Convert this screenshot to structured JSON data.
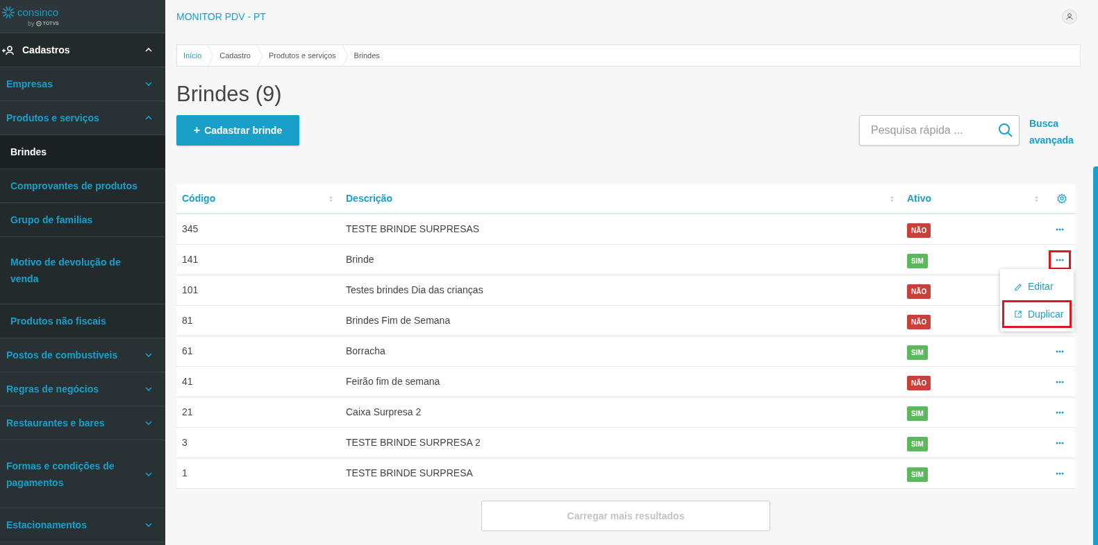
{
  "logo": {
    "name": "consinco",
    "by": "by",
    "brand": "TOTVS"
  },
  "sidebar": {
    "section": {
      "label": "Cadastros",
      "expanded": true
    },
    "items": [
      {
        "label": "Empresas",
        "expanded": false
      },
      {
        "label": "Produtos e serviços",
        "expanded": true,
        "children": [
          {
            "label": "Brindes",
            "selected": true
          },
          {
            "label": "Comprovantes de produtos",
            "selected": false
          },
          {
            "label": "Grupo de familias",
            "selected": false
          },
          {
            "label": "Motivo de devolução de venda",
            "selected": false
          },
          {
            "label": "Produtos não fiscais",
            "selected": false
          }
        ]
      },
      {
        "label": "Postos de combustiveis",
        "expanded": false
      },
      {
        "label": "Regras de negócios",
        "expanded": false
      },
      {
        "label": "Restaurantes e bares",
        "expanded": false
      },
      {
        "label": "Formas e condições de pagamentos",
        "expanded": false
      },
      {
        "label": "Estacionamentos",
        "expanded": false
      }
    ]
  },
  "header": {
    "title": "MONITOR PDV - PT"
  },
  "breadcrumb": [
    "Início",
    "Cadastro",
    "Produtos e serviços",
    "Brindes"
  ],
  "page_title": "Brindes (9)",
  "add_button": {
    "icon": "+",
    "label": "Cadastrar brinde"
  },
  "search": {
    "placeholder": "Pesquisa rápida ..."
  },
  "advanced_search": "Busca avançada",
  "table": {
    "columns": [
      "Código",
      "Descrição",
      "Ativo"
    ],
    "rows": [
      {
        "code": "345",
        "description": "TESTE BRINDE SURPRESAS",
        "active": false,
        "badge": "NÃO",
        "highlighted": false
      },
      {
        "code": "141",
        "description": "Brinde",
        "active": true,
        "badge": "SIM",
        "highlighted": true
      },
      {
        "code": "101",
        "description": "Testes brindes Dia das crianças",
        "active": false,
        "badge": "NÃO"
      },
      {
        "code": "81",
        "description": "Brindes Fim de Semana",
        "active": false,
        "badge": "NÃO"
      },
      {
        "code": "61",
        "description": "Borracha",
        "active": true,
        "badge": "SIM",
        "highlighted": false
      },
      {
        "code": "41",
        "description": "Feirão fim de semana",
        "active": false,
        "badge": "NÃO",
        "highlighted": false
      },
      {
        "code": "21",
        "description": "Caixa Surpresa 2",
        "active": true,
        "badge": "SIM",
        "highlighted": false
      },
      {
        "code": "3",
        "description": "TESTE BRINDE SURPRESA 2",
        "active": true,
        "badge": "SIM",
        "highlighted": false
      },
      {
        "code": "1",
        "description": "TESTE BRINDE SURPRESA",
        "active": true,
        "badge": "SIM",
        "highlighted": false
      }
    ]
  },
  "row_menu": {
    "items": [
      {
        "kind": "edit",
        "label": "Editar",
        "highlighted": false
      },
      {
        "kind": "duplicate",
        "label": "Duplicar",
        "highlighted": true
      }
    ]
  },
  "load_more": {
    "label": "Carregar mais resultados",
    "disabled": true
  }
}
